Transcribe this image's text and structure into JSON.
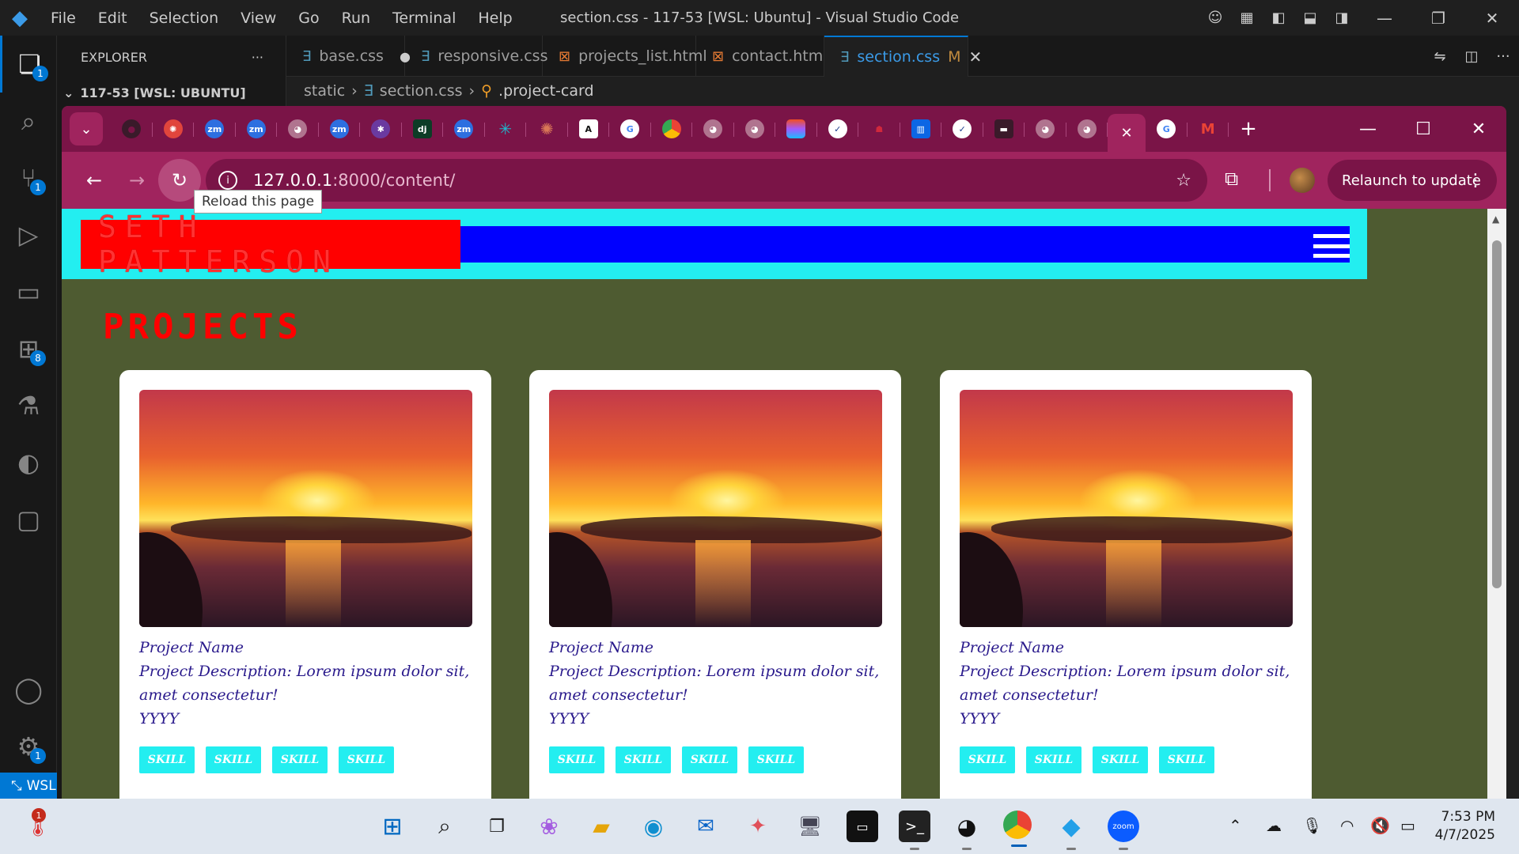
{
  "vscode": {
    "menu": [
      "File",
      "Edit",
      "Selection",
      "View",
      "Go",
      "Run",
      "Terminal",
      "Help"
    ],
    "window_title": "section.css - 117-53 [WSL: Ubuntu] - Visual Studio Code",
    "explorer_title": "EXPLORER",
    "explorer_more": "···",
    "folder": "117-53 [WSL: UBUNTU]",
    "tabs": [
      {
        "label": "base.css",
        "modified": "●"
      },
      {
        "label": "responsive.css"
      },
      {
        "label": "projects_list.html"
      },
      {
        "label": "contact.html"
      },
      {
        "label": "section.css",
        "status": "M"
      }
    ],
    "breadcrumb": [
      "static",
      "section.css",
      ".project-card"
    ],
    "activity_badges": {
      "explorer": "1",
      "source_control": "1",
      "extensions": "8",
      "settings": "1"
    },
    "status_remote": "WSL:"
  },
  "chrome": {
    "url_host": "127.0.0.1",
    "url_path": ":8000/content/",
    "tooltip": "Reload this page",
    "relaunch": "Relaunch to update",
    "tab_favicons": [
      "github-icon",
      "asterisk-red-icon",
      "zm-icon",
      "zm-icon",
      "globe-icon",
      "zm-icon",
      "bug-icon",
      "dj-icon",
      "zm-icon",
      "perplexity-icon",
      "claude-icon",
      "anthropic-icon",
      "google-icon",
      "chrome-icon",
      "globe-icon",
      "globe-icon",
      "figma-icon",
      "todo-icon",
      "cat-icon",
      "trello-icon",
      "todo-icon",
      "image-icon",
      "globe-icon",
      "globe-icon"
    ],
    "zm_label": "zm",
    "dj_label": "dj",
    "a_label": "A"
  },
  "page": {
    "brand": "SETH PATTERSON",
    "section_title": "PROJECTS",
    "cards": [
      {
        "name": "Project Name",
        "description": "Project Description: Lorem ipsum dolor sit, amet consectetur!",
        "year": "YYYY",
        "skills": [
          "SKILL",
          "SKILL",
          "SKILL",
          "SKILL"
        ]
      },
      {
        "name": "Project Name",
        "description": "Project Description: Lorem ipsum dolor sit, amet consectetur!",
        "year": "YYYY",
        "skills": [
          "SKILL",
          "SKILL",
          "SKILL",
          "SKILL"
        ]
      },
      {
        "name": "Project Name",
        "description": "Project Description: Lorem ipsum dolor sit, amet consectetur!",
        "year": "YYYY",
        "skills": [
          "SKILL",
          "SKILL",
          "SKILL",
          "SKILL"
        ]
      }
    ]
  },
  "taskbar": {
    "notification_badge": "1",
    "zoom_label": "zoom",
    "time": "7:53 PM",
    "date": "4/7/2025"
  }
}
